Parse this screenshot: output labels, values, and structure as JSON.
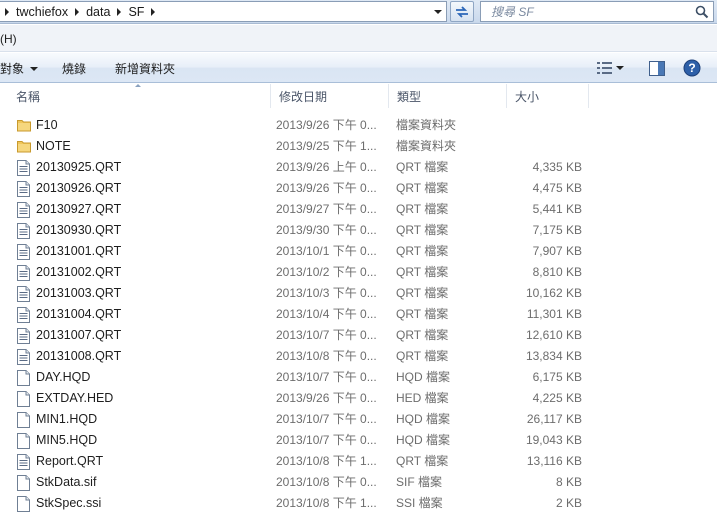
{
  "address": {
    "crumbs": [
      "twchiefox",
      "data",
      "SF"
    ]
  },
  "search": {
    "placeholder": "搜尋 SF"
  },
  "menu": {
    "help_label": "(H)"
  },
  "toolbar": {
    "organize_label": "對象",
    "burn_label": "燒錄",
    "new_folder_label": "新增資料夾"
  },
  "columns": {
    "name": "名稱",
    "date": "修改日期",
    "type": "類型",
    "size": "大小"
  },
  "files": [
    {
      "name": "F10",
      "date": "2013/9/26 下午 0...",
      "type": "檔案資料夾",
      "size": "",
      "kind": "folder"
    },
    {
      "name": "NOTE",
      "date": "2013/9/25 下午 1...",
      "type": "檔案資料夾",
      "size": "",
      "kind": "folder"
    },
    {
      "name": "20130925.QRT",
      "date": "2013/9/26 上午 0...",
      "type": "QRT 檔案",
      "size": "4,335 KB",
      "kind": "data"
    },
    {
      "name": "20130926.QRT",
      "date": "2013/9/26 下午 0...",
      "type": "QRT 檔案",
      "size": "4,475 KB",
      "kind": "data"
    },
    {
      "name": "20130927.QRT",
      "date": "2013/9/27 下午 0...",
      "type": "QRT 檔案",
      "size": "5,441 KB",
      "kind": "data"
    },
    {
      "name": "20130930.QRT",
      "date": "2013/9/30 下午 0...",
      "type": "QRT 檔案",
      "size": "7,175 KB",
      "kind": "data"
    },
    {
      "name": "20131001.QRT",
      "date": "2013/10/1 下午 0...",
      "type": "QRT 檔案",
      "size": "7,907 KB",
      "kind": "data"
    },
    {
      "name": "20131002.QRT",
      "date": "2013/10/2 下午 0...",
      "type": "QRT 檔案",
      "size": "8,810 KB",
      "kind": "data"
    },
    {
      "name": "20131003.QRT",
      "date": "2013/10/3 下午 0...",
      "type": "QRT 檔案",
      "size": "10,162 KB",
      "kind": "data"
    },
    {
      "name": "20131004.QRT",
      "date": "2013/10/4 下午 0...",
      "type": "QRT 檔案",
      "size": "11,301 KB",
      "kind": "data"
    },
    {
      "name": "20131007.QRT",
      "date": "2013/10/7 下午 0...",
      "type": "QRT 檔案",
      "size": "12,610 KB",
      "kind": "data"
    },
    {
      "name": "20131008.QRT",
      "date": "2013/10/8 下午 0...",
      "type": "QRT 檔案",
      "size": "13,834 KB",
      "kind": "data"
    },
    {
      "name": "DAY.HQD",
      "date": "2013/10/7 下午 0...",
      "type": "HQD 檔案",
      "size": "6,175 KB",
      "kind": "blank"
    },
    {
      "name": "EXTDAY.HED",
      "date": "2013/9/26 下午 0...",
      "type": "HED 檔案",
      "size": "4,225 KB",
      "kind": "blank"
    },
    {
      "name": "MIN1.HQD",
      "date": "2013/10/7 下午 0...",
      "type": "HQD 檔案",
      "size": "26,117 KB",
      "kind": "blank"
    },
    {
      "name": "MIN5.HQD",
      "date": "2013/10/7 下午 0...",
      "type": "HQD 檔案",
      "size": "19,043 KB",
      "kind": "blank"
    },
    {
      "name": "Report.QRT",
      "date": "2013/10/8 下午 1...",
      "type": "QRT 檔案",
      "size": "13,116 KB",
      "kind": "data"
    },
    {
      "name": "StkData.sif",
      "date": "2013/10/8 下午 0...",
      "type": "SIF 檔案",
      "size": "8 KB",
      "kind": "blank"
    },
    {
      "name": "StkSpec.ssi",
      "date": "2013/10/8 下午 1...",
      "type": "SSI 檔案",
      "size": "2 KB",
      "kind": "blank"
    }
  ],
  "colors": {
    "folder": "#e8b84a",
    "accent": "#2a5a9a"
  }
}
